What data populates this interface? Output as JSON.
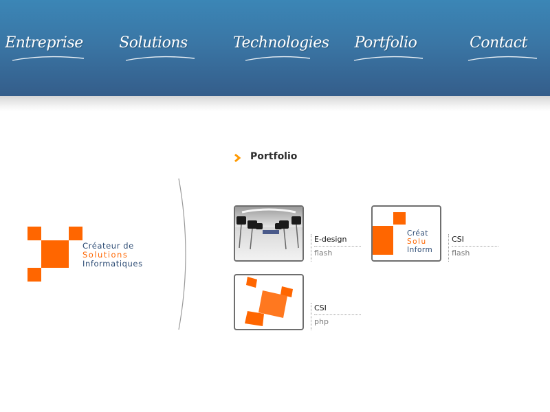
{
  "nav": {
    "items": [
      {
        "label": "Entreprise"
      },
      {
        "label": "Solutions"
      },
      {
        "label": "Technologies"
      },
      {
        "label": "Portfolio"
      },
      {
        "label": "Contact"
      }
    ]
  },
  "logo": {
    "line1": "Créateur de",
    "line2": "Solutions",
    "line3": "Informatiques"
  },
  "section": {
    "title": "Portfolio",
    "icon": "chevron-right-icon"
  },
  "portfolio": {
    "items": [
      {
        "title": "E-design",
        "type": "flash",
        "thumb": "conference-room-image"
      },
      {
        "title": "CSI",
        "type": "flash",
        "thumb": "csi-logo-image",
        "thumb_text": [
          "Créat",
          "Solu",
          "Inform"
        ]
      },
      {
        "title": "CSI",
        "type": "php",
        "thumb": "csi-3d-logo-image"
      }
    ]
  },
  "colors": {
    "header_top": "#3b86b6",
    "header_bottom": "#345d8a",
    "brand_orange": "#ff6600",
    "brand_blue": "#2b4a73"
  }
}
